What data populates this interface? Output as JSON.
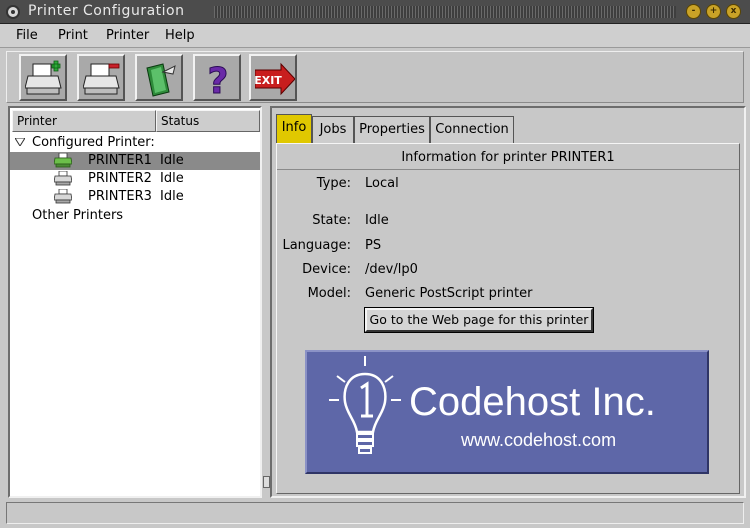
{
  "window": {
    "title": "Printer Configuration",
    "wm_buttons": [
      "-",
      "+",
      "x"
    ]
  },
  "menu": {
    "items": [
      "File",
      "Print",
      "Printer",
      "Help"
    ]
  },
  "toolbar": {
    "buttons": [
      {
        "name": "add-printer-button",
        "icon": "add-printer-icon"
      },
      {
        "name": "remove-printer-button",
        "icon": "remove-printer-icon"
      },
      {
        "name": "edit-printer-button",
        "icon": "edit-printer-icon"
      },
      {
        "name": "help-button",
        "icon": "question-mark-icon",
        "label": "?"
      },
      {
        "name": "exit-button",
        "icon": "exit-icon",
        "label": "EXIT"
      }
    ]
  },
  "tree": {
    "columns": [
      "Printer",
      "Status"
    ],
    "configured_label": "Configured Printer:",
    "printers": [
      {
        "name": "PRINTER1",
        "status": "Idle",
        "selected": true
      },
      {
        "name": "PRINTER2",
        "status": "Idle",
        "selected": false
      },
      {
        "name": "PRINTER3",
        "status": "Idle",
        "selected": false
      }
    ],
    "other_label": "Other Printers"
  },
  "tabs": [
    {
      "label": "Info",
      "active": true
    },
    {
      "label": "Jobs",
      "active": false
    },
    {
      "label": "Properties",
      "active": false
    },
    {
      "label": "Connection",
      "active": false
    }
  ],
  "info": {
    "header": "Information for printer PRINTER1",
    "fields": {
      "type": {
        "label": "Type:",
        "value": "Local"
      },
      "state": {
        "label": "State:",
        "value": "Idle"
      },
      "language": {
        "label": "Language:",
        "value": "PS"
      },
      "device": {
        "label": "Device:",
        "value": "/dev/lp0"
      },
      "model": {
        "label": "Model:",
        "value": "Generic PostScript printer"
      }
    },
    "web_button": "Go to the Web page for this printer"
  },
  "logo": {
    "name": "Codehost Inc.",
    "url": "www.codehost.com"
  },
  "colors": {
    "active_tab": "#e0c800",
    "selection": "#8a8a8a",
    "logo_bg": "#5e67a8",
    "titlebar": "#4c4c4c"
  }
}
